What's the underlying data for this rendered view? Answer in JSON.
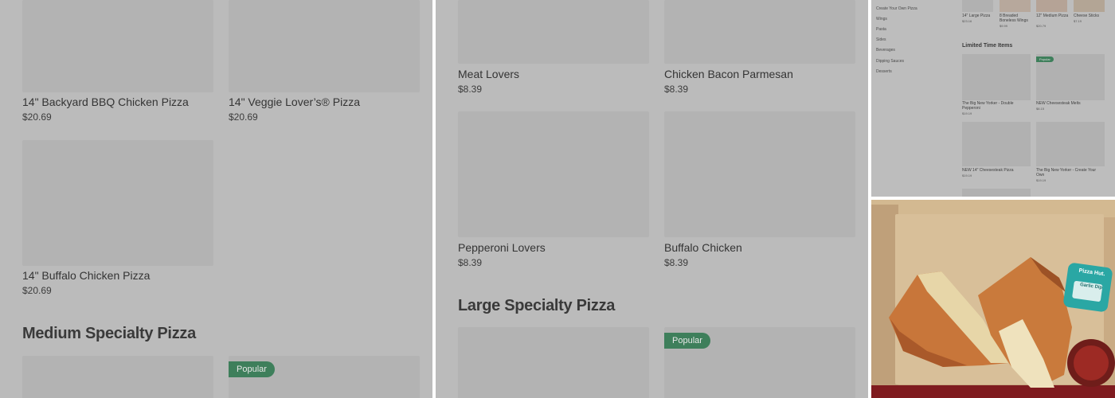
{
  "panel_a": {
    "items": [
      {
        "name": "14\" Backyard BBQ Chicken Pizza",
        "price": "$20.69"
      },
      {
        "name": "14\" Veggie Lover’s® Pizza",
        "price": "$20.69"
      },
      {
        "name": "14\" Buffalo Chicken Pizza",
        "price": "$20.69"
      }
    ],
    "section_title": "Medium Specialty Pizza",
    "badge": "Popular"
  },
  "panel_b": {
    "items": [
      {
        "name": "Meat Lovers",
        "price": "$8.39"
      },
      {
        "name": "Chicken Bacon Parmesan",
        "price": "$8.39"
      },
      {
        "name": "Pepperoni Lovers",
        "price": "$8.39"
      },
      {
        "name": "Buffalo Chicken",
        "price": "$8.39"
      }
    ],
    "section_title": "Large Specialty Pizza",
    "badge": "Popular"
  },
  "panel_c": {
    "nav": [
      "Create Your Own Pizza",
      "Wings",
      "Pasta",
      "Sides",
      "Beverages",
      "Dipping Sauces",
      "Desserts"
    ],
    "top_items": [
      {
        "name": "14\" Large Pizza",
        "price": "$23.16"
      },
      {
        "name": "8 Breaded Boneless Wings",
        "price": "$9.99"
      },
      {
        "name": "12\" Medium Pizza",
        "price": "$20.79"
      },
      {
        "name": "Cheese Sticks",
        "price": "$7.19"
      }
    ],
    "section_title": "Limited Time Items",
    "badge": "Popular",
    "items": [
      {
        "name": "The Big New Yorker - Double Pepperoni",
        "price": "$19.19"
      },
      {
        "name": "NEW Cheesesteak Melts",
        "price": "$8.15"
      },
      {
        "name": "NEW 14\" Cheesesteak Pizza",
        "price": "$19.19"
      },
      {
        "name": "The Big New Yorker - Create Your Own",
        "price": "$19.19"
      }
    ]
  },
  "photo": {
    "sauce_label": "Pizza Hut.",
    "sauce_sub": "Garlic Dip"
  },
  "colors": {
    "overlay_gray": "#bbbbbb",
    "badge_green": "#3e7f5b"
  }
}
